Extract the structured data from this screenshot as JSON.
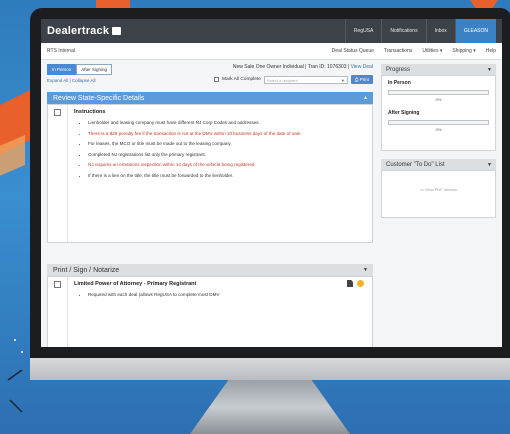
{
  "app": {
    "brand": "Dealertrack",
    "top_nav": [
      "RegUSA",
      "Notifications",
      "Inbox",
      "GLEASON"
    ],
    "sub_left": "RTS Internal",
    "sub_menus": [
      "Deal Status Queue",
      "Transactions",
      "Utilities ▾",
      "Shipping ▾",
      "Help"
    ]
  },
  "toolbar": {
    "toggle": [
      "In Person",
      "After Signing"
    ],
    "expand_collapse": "Expand All | Collapse All",
    "deal_info": "New Sale One Owner Individual | Tran ID: 1076303 |",
    "view_deal": "View Deal",
    "mark_all": "Mark All Complete",
    "select_placeholder": "Select a recipient",
    "print": "Print"
  },
  "review": {
    "header": "Review State-Specific Details",
    "title": "Instructions",
    "items": [
      {
        "text": "Lienholder and leasing company must have different NJ Corp Codes and addresses.",
        "red": false
      },
      {
        "text": "There is a $25 penalty fee if the transaction is not at the DMV within 10 business days of the date of sale.",
        "red": true
      },
      {
        "text": "For leases, the MCO or title must be made out to the leasing company.",
        "red": false
      },
      {
        "text": "Completed NJ registrations list only the primary registrant.",
        "red": false
      },
      {
        "text": "NJ requires an emissions inspection within 14 days of the vehicle being registered.",
        "red": true
      },
      {
        "text": "If there is a lien on the title, the title must be forwarded to the lienholder.",
        "red": false
      }
    ]
  },
  "print_section": {
    "header": "Print / Sign / Notarize",
    "title": "Limited Power of Attorney - Primary Registrant",
    "items": [
      "Required with each deal (allows RegUSA to complete most DMV"
    ]
  },
  "progress": {
    "header": "Progress",
    "in_person_label": "In Person",
    "in_person_pct": "0%",
    "after_label": "After Signing",
    "after_pct": "0%",
    "in_person_value": 0,
    "after_value": 0
  },
  "todo": {
    "header": "Customer \"To Do\" List",
    "link": "View PDF Version"
  }
}
